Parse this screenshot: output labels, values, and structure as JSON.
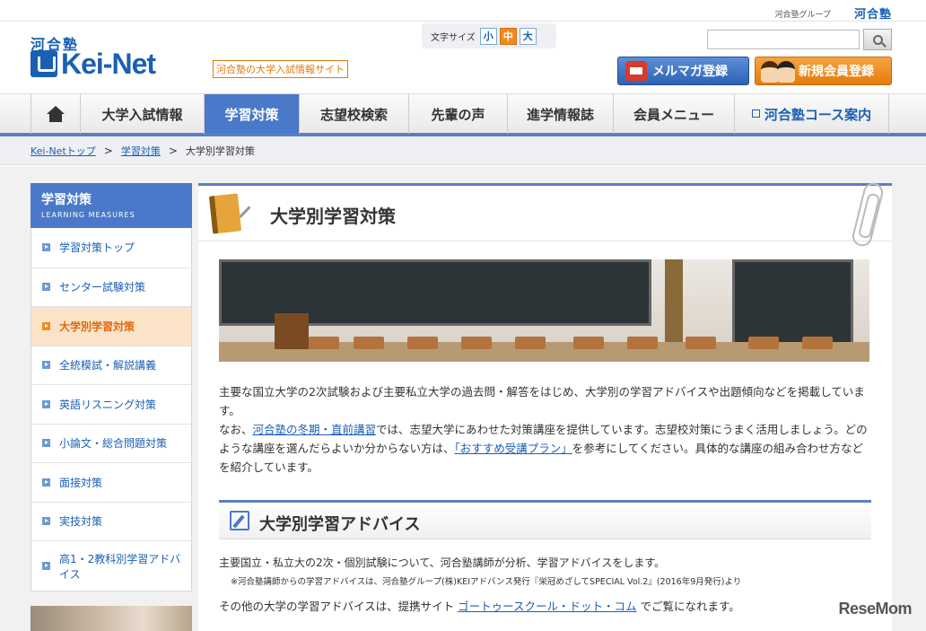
{
  "topbar": {
    "group_label": "河合塾グループ",
    "group_logo": "河合塾"
  },
  "header": {
    "logo_kawai": "河合塾",
    "logo_main": "Kei-Net",
    "tagline": "河合塾の大学入試情報サイト",
    "fontsize": {
      "label": "文字サイズ",
      "small": "小",
      "medium": "中",
      "large": "大",
      "selected": "中"
    },
    "search": {
      "value": "",
      "placeholder": "",
      "button_icon": "search-icon"
    },
    "mailmag_button": "メルマガ登録",
    "register_button": "新規会員登録"
  },
  "gnav": {
    "home_icon": "home-icon",
    "items": [
      {
        "label": "大学入試情報"
      },
      {
        "label": "学習対策"
      },
      {
        "label": "志望校検索"
      },
      {
        "label": "先輩の声"
      },
      {
        "label": "進学情報誌"
      },
      {
        "label": "会員メニュー"
      },
      {
        "label": "河合塾コース案内"
      }
    ],
    "active": "学習対策"
  },
  "breadcrumb": {
    "home": "Kei-Netトップ",
    "parent": "学習対策",
    "current": "大学別学習対策"
  },
  "sidebar": {
    "title": "学習対策",
    "subtitle": "LEARNING MEASURES",
    "items": [
      {
        "label": "学習対策トップ"
      },
      {
        "label": "センター試験対策"
      },
      {
        "label": "大学別学習対策"
      },
      {
        "label": "全統模試・解説講義"
      },
      {
        "label": "英語リスニング対策"
      },
      {
        "label": "小論文・総合問題対策"
      },
      {
        "label": "面接対策"
      },
      {
        "label": "実技対策"
      },
      {
        "label": "高1・2教科別学習アドバイス"
      }
    ],
    "active": "大学別学習対策"
  },
  "main": {
    "title": "大学別学習対策",
    "intro": {
      "p1": "主要な国立大学の2次試験および主要私立大学の過去問・解答をはじめ、大学別の学習アドバイスや出題傾向などを掲載しています。",
      "p2_a": "なお、",
      "p2_link1": "河合塾の冬期・直前講習",
      "p2_b": "では、志望大学にあわせた対策講座を提供しています。志望校対策にうまく活用しましょう。どのような講座を選んだらよいか分からない方は、",
      "p2_link2": "「おすすめ受講プラン」",
      "p2_c": "を参考にしてください。具体的な講座の組み合わせ方などを紹介しています。"
    },
    "section": {
      "title": "大学別学習アドバイス",
      "text1": "主要国立・私立大の2次・個別試験について、河合塾講師が分析、学習アドバイスをします。",
      "note": "※河合塾講師からの学習アドバイスは、河合塾グループ(株)KEIアドバンス発行『栄冠めざしてSPECIAL Vol.2』(2016年9月発行)より",
      "text2_a": "その他の大学の学習アドバイスは、提携サイト ",
      "text2_link": "ゴートゥースクール・ドット・コム",
      "text2_b": " でご覧になれます。"
    }
  },
  "watermark": "ReseMom"
}
